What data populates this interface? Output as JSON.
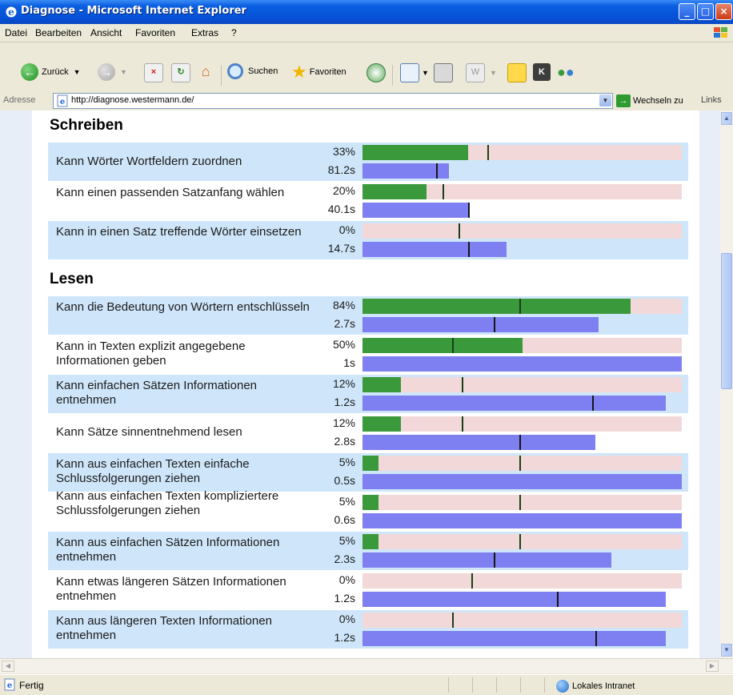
{
  "window": {
    "title": "Diagnose - Microsoft Internet Explorer"
  },
  "menu": [
    "Datei",
    "Bearbeiten",
    "Ansicht",
    "Favoriten",
    "Extras",
    "?"
  ],
  "toolbar": {
    "back": "Zurück",
    "search": "Suchen",
    "favorites": "Favoriten"
  },
  "address": {
    "label": "Adresse",
    "url": "http://diagnose.westermann.de/",
    "go": "Wechseln zu",
    "links": "Links"
  },
  "status": {
    "text": "Fertig",
    "zone": "Lokales Intranet"
  },
  "sections": [
    {
      "title": "Schreiben",
      "rows": [
        {
          "label": "Kann Wörter Wortfeldern zuordnen",
          "pct": "33%",
          "time": "81.2s",
          "score": 0.33,
          "score_avg": 0.39,
          "time_fill": 0.27,
          "time_avg": 0.23
        },
        {
          "label": "Kann einen passenden Satzanfang wählen",
          "pct": "20%",
          "time": "40.1s",
          "score": 0.2,
          "score_avg": 0.25,
          "time_fill": 0.33,
          "time_avg": 0.33
        },
        {
          "label": "Kann in einen Satz treffende Wörter einsetzen",
          "pct": "0%",
          "time": "14.7s",
          "score": 0.0,
          "score_avg": 0.3,
          "time_fill": 0.45,
          "time_avg": 0.33
        }
      ]
    },
    {
      "title": "Lesen",
      "rows": [
        {
          "label": "Kann die Bedeutung von Wörtern entschlüsseln",
          "pct": "84%",
          "time": "2.7s",
          "score": 0.84,
          "score_avg": 0.49,
          "time_fill": 0.74,
          "time_avg": 0.41
        },
        {
          "label": "Kann in Texten explizit angegebene Informationen geben",
          "pct": "50%",
          "time": "1s",
          "score": 0.5,
          "score_avg": 0.28,
          "time_fill": 1.0,
          "time_avg": null
        },
        {
          "label": "Kann einfachen Sätzen Informationen entnehmen",
          "pct": "12%",
          "time": "1.2s",
          "score": 0.12,
          "score_avg": 0.31,
          "time_fill": 0.95,
          "time_avg": 0.72
        },
        {
          "label": "Kann Sätze sinnentnehmend lesen",
          "pct": "12%",
          "time": "2.8s",
          "score": 0.12,
          "score_avg": 0.31,
          "time_fill": 0.73,
          "time_avg": 0.49
        },
        {
          "label": "Kann aus einfachen Texten einfache Schlussfolgerungen ziehen",
          "pct": "5%",
          "time": "0.5s",
          "score": 0.05,
          "score_avg": 0.49,
          "time_fill": 1.0,
          "time_avg": null
        },
        {
          "label": "Kann aus einfachen Texten kompliziertere Schlussfolgerungen ziehen",
          "pct": "5%",
          "time": "0.6s",
          "score": 0.05,
          "score_avg": 0.49,
          "time_fill": 1.0,
          "time_avg": null
        },
        {
          "label": "Kann aus einfachen Sätzen Informationen entnehmen",
          "pct": "5%",
          "time": "2.3s",
          "score": 0.05,
          "score_avg": 0.49,
          "time_fill": 0.78,
          "time_avg": 0.41
        },
        {
          "label": "Kann etwas längeren Sätzen Informationen entnehmen",
          "pct": "0%",
          "time": "1.2s",
          "score": 0.0,
          "score_avg": 0.34,
          "time_fill": 0.95,
          "time_avg": 0.61
        },
        {
          "label": "Kann aus längeren Texten Informationen entnehmen",
          "pct": "0%",
          "time": "1.2s",
          "score": 0.0,
          "score_avg": 0.28,
          "time_fill": 0.95,
          "time_avg": 0.73
        }
      ]
    }
  ],
  "colors": {
    "score": "#3a993a",
    "score_bg": "#f2d8d8",
    "time": "#7e7ff0",
    "row_alt": "#cfe6fa"
  }
}
